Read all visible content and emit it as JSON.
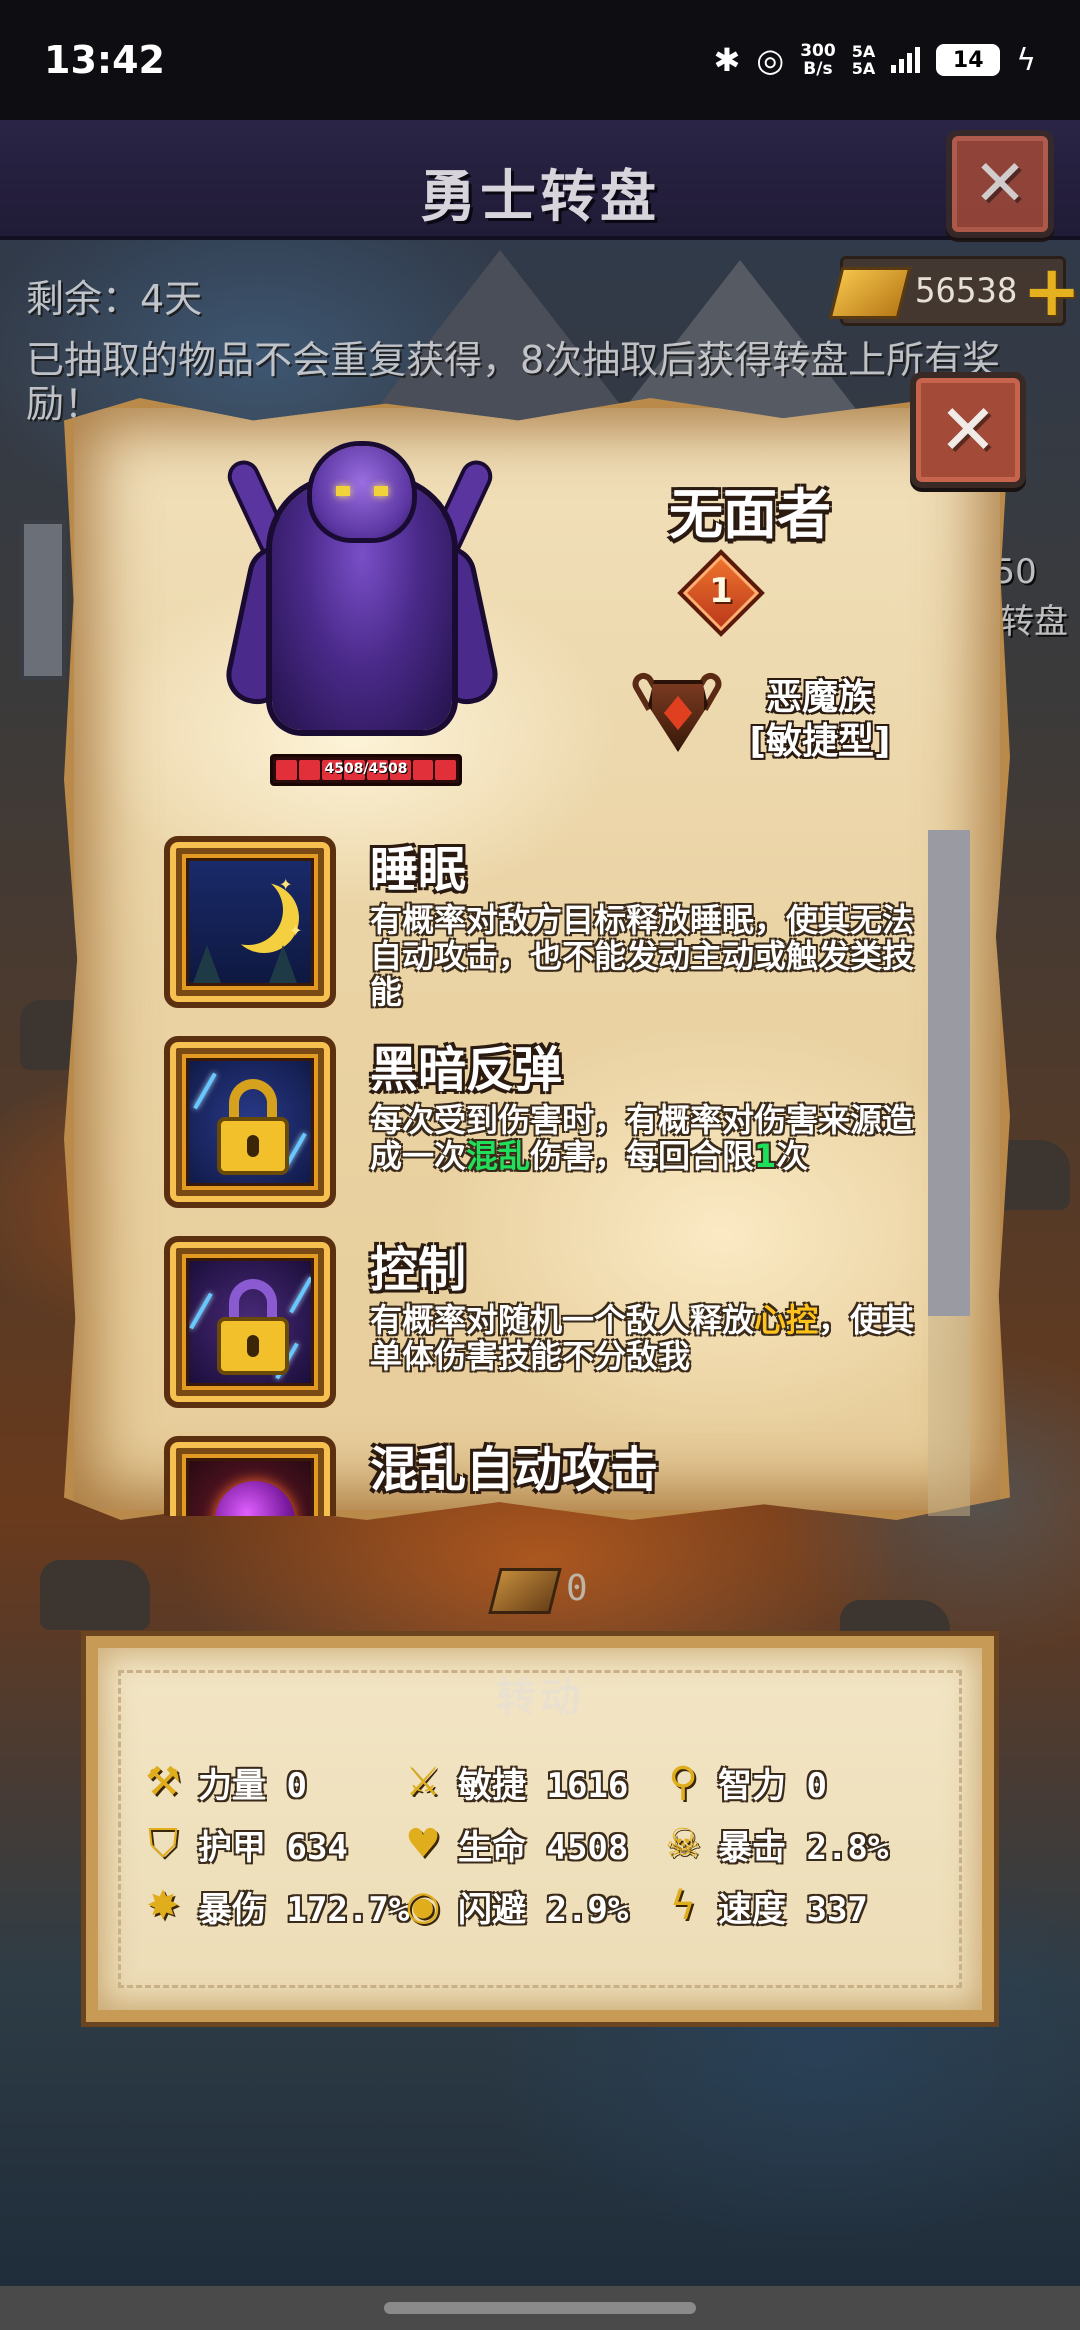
{
  "status_bar": {
    "time": "13:42",
    "net_rate_top": "300",
    "net_rate_bottom": "B/s",
    "signal_1": "5A",
    "signal_2": "5A",
    "battery": "14",
    "icons": [
      "bluetooth-icon",
      "alarm-icon",
      "signal-icon",
      "battery-icon",
      "charging-icon"
    ]
  },
  "header": {
    "title": "勇士转盘",
    "close_label": "✕"
  },
  "info": {
    "remaining": "剩余：4天",
    "currency_amount": "56538",
    "currency_plus": "+",
    "notice": "已抽取的物品不会重复获得，8次抽取后获得转盘上所有奖励！",
    "side_progress": "/50",
    "side_label": "转盘"
  },
  "popup": {
    "close_label": "✕",
    "monster_name": "无面者",
    "level": "1",
    "hp_text": "4508/4508",
    "race_line1": "恶魔族",
    "race_line2": "[敏捷型]",
    "skills": [
      {
        "name": "睡眠",
        "desc": "有概率对敌方目标释放睡眠，使其无法自动攻击，也不能发动主动或触发类技能",
        "icon": "moon-icon"
      },
      {
        "name": "黑暗反弹",
        "desc_pre": "每次受到伤害时，有概率对伤害来源造成一次",
        "desc_kw": "混乱",
        "desc_mid": "伤害，每回合限",
        "desc_num": "1",
        "desc_post": "次",
        "icon": "dark-lock-icon"
      },
      {
        "name": "控制",
        "desc_pre": "有概率对随机一个敌人释放",
        "desc_kw": "心控",
        "desc_post": "，使其单体伤害技能不分敌我",
        "icon": "control-lock-icon"
      },
      {
        "name": "混乱自动攻击",
        "icon": "chaos-orb-icon"
      }
    ],
    "colors": {
      "keyword_green": "#1ee05a",
      "keyword_yellow": "#ffc21a"
    }
  },
  "spin": {
    "cost": "0",
    "button_label": "转动"
  },
  "stats": [
    {
      "icon": "axe-icon",
      "label": "力量 0"
    },
    {
      "icon": "sword-icon",
      "label": "敏捷 1616"
    },
    {
      "icon": "staff-icon",
      "label": "智力 0"
    },
    {
      "icon": "shield-icon",
      "label": "护甲 634"
    },
    {
      "icon": "heart-icon",
      "label": "生命 4508"
    },
    {
      "icon": "skull-icon",
      "label": "暴击 2.8%"
    },
    {
      "icon": "explosion-icon",
      "label": "暴伤 172.7%"
    },
    {
      "icon": "eye-icon",
      "label": "闪避 2.9%"
    },
    {
      "icon": "lightning-icon",
      "label": "速度 337"
    }
  ]
}
